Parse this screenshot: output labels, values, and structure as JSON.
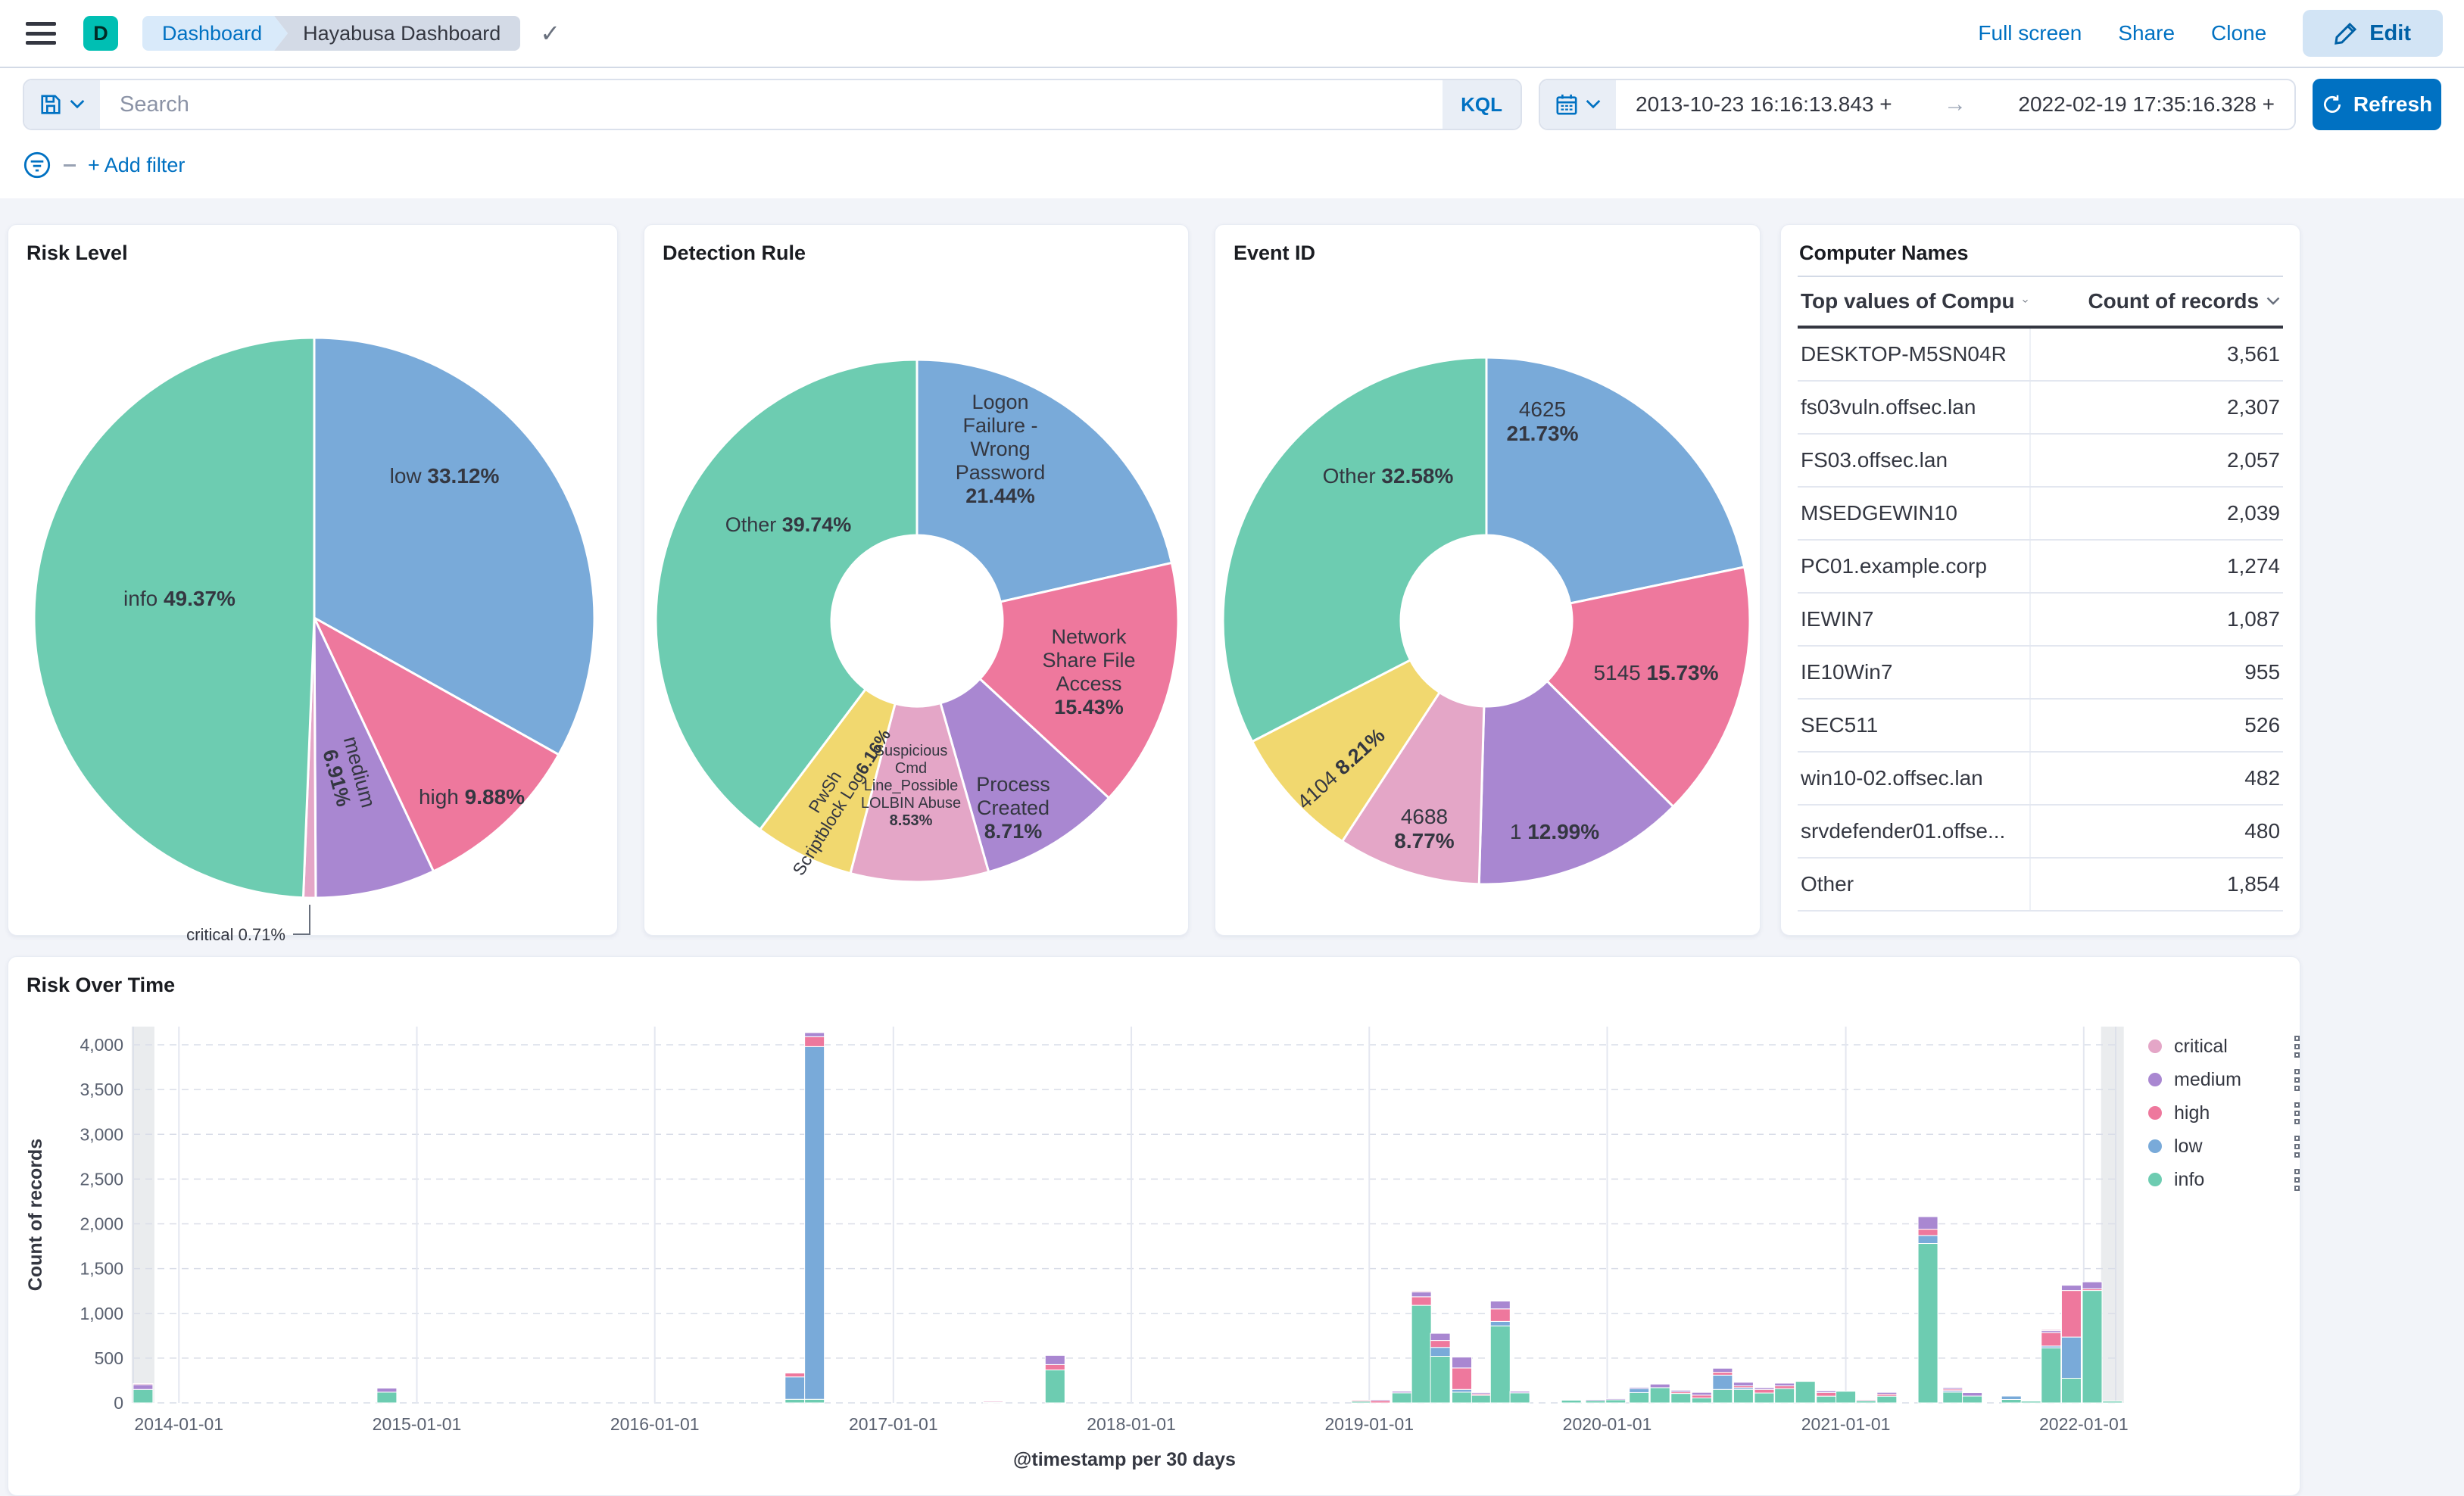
{
  "navbar": {
    "logo_letter": "D",
    "breadcrumbs": [
      "Dashboard",
      "Hayabusa Dashboard"
    ],
    "links": [
      "Full screen",
      "Share",
      "Clone"
    ],
    "edit_label": "Edit"
  },
  "querybar": {
    "search_placeholder": "Search",
    "kql_label": "KQL",
    "date_start": "2013-10-23 16:16:13.843 +",
    "date_end": "2022-02-19 17:35:16.328 +",
    "refresh_label": "Refresh"
  },
  "filterbar": {
    "add_filter_label": "+ Add filter"
  },
  "panels": {
    "computer_names": {
      "title": "Computer Names",
      "columns": [
        "Top values of Compu",
        "Count of records"
      ],
      "rows": [
        {
          "name": "DESKTOP-M5SN04R",
          "count": "3,561"
        },
        {
          "name": "fs03vuln.offsec.lan",
          "count": "2,307"
        },
        {
          "name": "FS03.offsec.lan",
          "count": "2,057"
        },
        {
          "name": "MSEDGEWIN10",
          "count": "2,039"
        },
        {
          "name": "PC01.example.corp",
          "count": "1,274"
        },
        {
          "name": "IEWIN7",
          "count": "1,087"
        },
        {
          "name": "IE10Win7",
          "count": "955"
        },
        {
          "name": "SEC511",
          "count": "526"
        },
        {
          "name": "win10-02.offsec.lan",
          "count": "482"
        },
        {
          "name": "srvdefender01.offse...",
          "count": "480"
        },
        {
          "name": "Other",
          "count": "1,854"
        }
      ]
    }
  },
  "chart_data": {
    "risk_level": {
      "type": "pie",
      "title": "Risk Level",
      "slices": [
        {
          "name": "low",
          "pct": "33.12%",
          "value": 33.12,
          "color": "#79AAD9"
        },
        {
          "name": "high",
          "pct": "9.88%",
          "value": 9.88,
          "color": "#EE789D"
        },
        {
          "name": "medium",
          "pct": "6.91%",
          "value": 6.91,
          "color": "#A987D1"
        },
        {
          "name": "critical",
          "pct": "0.71%",
          "value": 0.71,
          "color": "#E4A6C7"
        },
        {
          "name": "info",
          "pct": "49.37%",
          "value": 49.37,
          "color": "#6DCCB1"
        }
      ]
    },
    "detection_rule": {
      "type": "donut",
      "title": "Detection Rule",
      "slices": [
        {
          "name": "Logon Failure - Wrong Password",
          "label_lines": [
            "Logon",
            "Failure -",
            "Wrong",
            "Password"
          ],
          "pct": "21.44%",
          "value": 21.44,
          "color": "#79AAD9"
        },
        {
          "name": "Network Share File Access",
          "label_lines": [
            "Network",
            "Share File",
            "Access"
          ],
          "pct": "15.43%",
          "value": 15.43,
          "color": "#EE789D"
        },
        {
          "name": "Process Created",
          "label_lines": [
            "Process",
            "Created"
          ],
          "pct": "8.71%",
          "value": 8.71,
          "color": "#A987D1"
        },
        {
          "name": "Suspicious Cmd Line_Possible LOLBIN Abuse",
          "label_lines": [
            "Suspicious",
            "Cmd",
            "Line_Possible",
            "LOLBIN Abuse"
          ],
          "pct": "8.53%",
          "value": 8.53,
          "color": "#E4A6C7"
        },
        {
          "name": "PwSh Scriptblock Log",
          "label_lines": [
            "PwSh",
            "Scriptblock Log"
          ],
          "pct": "6.16%",
          "value": 6.16,
          "color": "#F1D86F"
        },
        {
          "name": "Other",
          "pct": "39.74%",
          "value": 39.74,
          "color": "#6DCCB1"
        }
      ]
    },
    "event_id": {
      "type": "donut",
      "title": "Event ID",
      "slices": [
        {
          "name": "4625",
          "label_lines": [
            "4625"
          ],
          "pct": "21.73%",
          "value": 21.73,
          "color": "#79AAD9"
        },
        {
          "name": "5145",
          "pct": "15.73%",
          "value": 15.73,
          "color": "#EE789D"
        },
        {
          "name": "1",
          "pct": "12.99%",
          "value": 12.99,
          "color": "#A987D1"
        },
        {
          "name": "4688",
          "label_lines": [
            "4688"
          ],
          "pct": "8.77%",
          "value": 8.77,
          "color": "#E4A6C7"
        },
        {
          "name": "4104",
          "pct": "8.21%",
          "value": 8.21,
          "color": "#F1D86F"
        },
        {
          "name": "Other",
          "pct": "32.58%",
          "value": 32.58,
          "color": "#6DCCB1"
        }
      ]
    },
    "risk_over_time": {
      "type": "bar_stacked",
      "title": "Risk Over Time",
      "xlabel": "@timestamp per 30 days",
      "ylabel": "Count of records",
      "time_range": {
        "start": "2013-10-23",
        "end": "2022-02-19"
      },
      "x_ticks": [
        "2014-01-01",
        "2015-01-01",
        "2016-01-01",
        "2017-01-01",
        "2018-01-01",
        "2019-01-01",
        "2020-01-01",
        "2021-01-01",
        "2022-01-01"
      ],
      "y_ticks": [
        0,
        500,
        1000,
        1500,
        2000,
        2500,
        3000,
        3500,
        4000
      ],
      "series_order": [
        "info",
        "low",
        "high",
        "medium",
        "critical"
      ],
      "legend": [
        {
          "name": "critical",
          "color": "#E4A6C7"
        },
        {
          "name": "medium",
          "color": "#A987D1"
        },
        {
          "name": "high",
          "color": "#EE789D"
        },
        {
          "name": "low",
          "color": "#79AAD9"
        },
        {
          "name": "info",
          "color": "#6DCCB1"
        }
      ],
      "partial_buckets": [
        "2013-11-07",
        "2022-02-14"
      ],
      "bars": [
        {
          "date": "2013-11-07",
          "info": 150,
          "medium": 58,
          "critical": 8
        },
        {
          "date": "2014-11-16",
          "info": 120,
          "medium": 45
        },
        {
          "date": "2016-08-03",
          "info": 40,
          "low": 250,
          "high": 43
        },
        {
          "date": "2016-09-02",
          "info": 40,
          "low": 3940,
          "high": 110,
          "medium": 46
        },
        {
          "date": "2017-06-03",
          "info": 12,
          "critical": 7
        },
        {
          "date": "2017-09-06",
          "info": 368,
          "high": 60,
          "medium": 102
        },
        {
          "date": "2018-12-20",
          "info": 22,
          "high": 8
        },
        {
          "date": "2019-01-18",
          "high": 25,
          "medium": 13
        },
        {
          "date": "2019-02-20",
          "info": 112,
          "medium": 18
        },
        {
          "date": "2019-03-22",
          "info": 1090,
          "high": 95,
          "medium": 56,
          "critical": 10
        },
        {
          "date": "2019-04-20",
          "info": 520,
          "low": 100,
          "high": 77,
          "medium": 80
        },
        {
          "date": "2019-05-23",
          "info": 120,
          "low": 30,
          "high": 240,
          "medium": 122
        },
        {
          "date": "2019-06-22",
          "info": 84,
          "high": 16,
          "medium": 15
        },
        {
          "date": "2019-07-21",
          "info": 860,
          "low": 50,
          "high": 140,
          "medium": 87
        },
        {
          "date": "2019-08-20",
          "info": 112,
          "medium": 18
        },
        {
          "date": "2019-11-07",
          "info": 30
        },
        {
          "date": "2019-12-14",
          "info": 30,
          "medium": 8
        },
        {
          "date": "2020-01-14",
          "info": 35,
          "medium": 12
        },
        {
          "date": "2020-02-19",
          "info": 115,
          "low": 45,
          "medium": 14
        },
        {
          "date": "2020-03-22",
          "info": 170,
          "medium": 40
        },
        {
          "date": "2020-04-23",
          "info": 105,
          "high": 18,
          "medium": 18
        },
        {
          "date": "2020-05-25",
          "info": 55,
          "high": 32,
          "medium": 30
        },
        {
          "date": "2020-06-26",
          "info": 150,
          "low": 160,
          "high": 32,
          "medium": 45
        },
        {
          "date": "2020-07-28",
          "info": 150,
          "low": 20,
          "high": 20,
          "medium": 40
        },
        {
          "date": "2020-08-29",
          "info": 110,
          "high": 40,
          "medium": 20
        },
        {
          "date": "2020-09-29",
          "info": 160,
          "high": 30,
          "medium": 30
        },
        {
          "date": "2020-10-31",
          "info": 240
        },
        {
          "date": "2020-12-02",
          "info": 75,
          "high": 40,
          "medium": 20
        },
        {
          "date": "2021-01-01",
          "info": 130
        },
        {
          "date": "2021-02-01",
          "info": 26,
          "critical": 10
        },
        {
          "date": "2021-03-05",
          "info": 75,
          "high": 22,
          "medium": 20
        },
        {
          "date": "2021-05-07",
          "info": 1780,
          "low": 90,
          "high": 70,
          "medium": 140
        },
        {
          "date": "2021-06-14",
          "info": 120,
          "low": 17,
          "high": 17,
          "medium": 17
        },
        {
          "date": "2021-07-14",
          "info": 76,
          "medium": 38
        },
        {
          "date": "2021-09-12",
          "info": 38,
          "low": 38
        },
        {
          "date": "2021-10-12",
          "info": 19
        },
        {
          "date": "2021-11-12",
          "info": 615,
          "low": 20,
          "high": 150,
          "medium": 24,
          "critical": 10
        },
        {
          "date": "2021-12-13",
          "info": 275,
          "low": 460,
          "high": 520,
          "medium": 59
        },
        {
          "date": "2022-01-14",
          "info": 1255,
          "high": 20,
          "medium": 77
        },
        {
          "date": "2022-02-14",
          "info": 19
        }
      ]
    }
  }
}
